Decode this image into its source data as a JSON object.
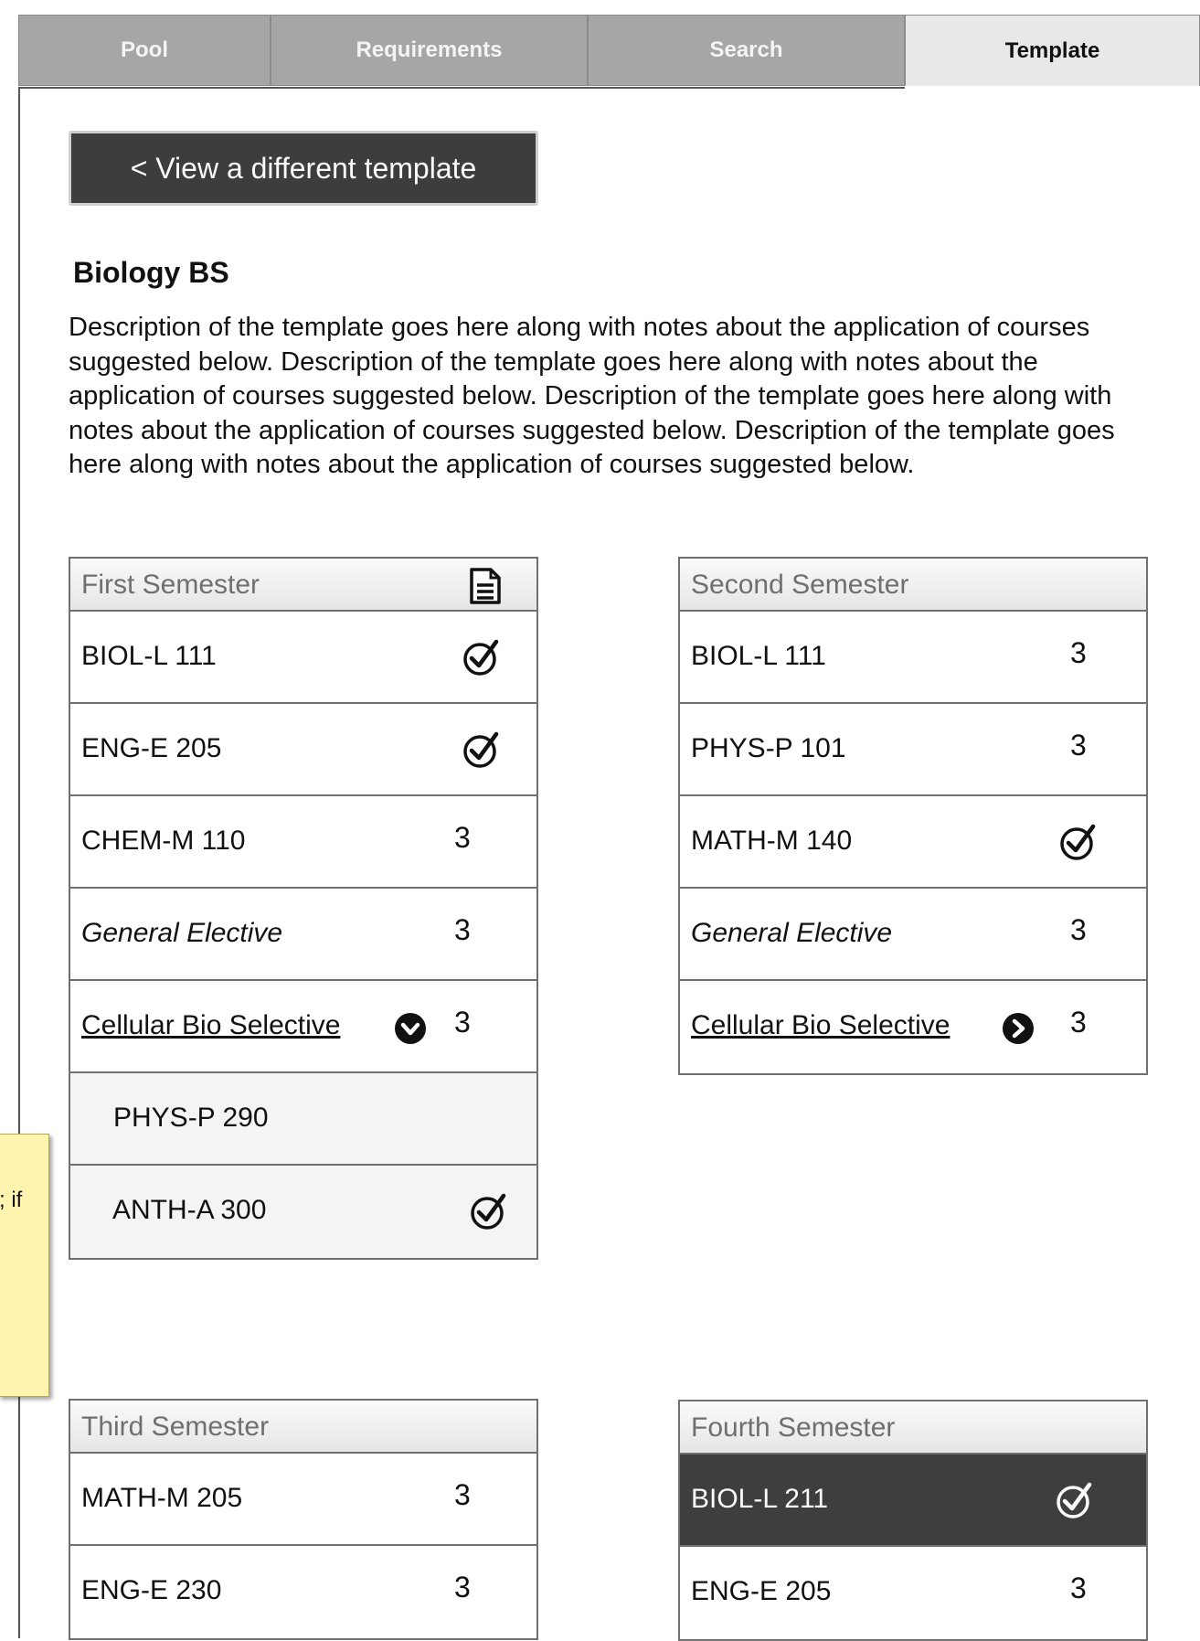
{
  "tabs": [
    {
      "label": "Pool",
      "active": false
    },
    {
      "label": "Requirements",
      "active": false
    },
    {
      "label": "Search",
      "active": false
    },
    {
      "label": "Template",
      "active": true
    }
  ],
  "back_button": "< View a different template",
  "template": {
    "title": "Biology BS",
    "description": "Description of the template goes here along with notes about the application of courses suggested below.  Description of the template goes here along with notes about the application of courses suggested below. Description of the template goes here along with notes about the application of courses suggested below. Description of the template goes here along with notes about the application of courses suggested below."
  },
  "sticky_note": {
    "visible_text": "; if"
  },
  "semesters": [
    {
      "title": "First Semester",
      "rows": [
        {
          "label": "BIOL-L 111",
          "credits": "",
          "status": "check-circle-icon"
        },
        {
          "label": "ENG-E 205",
          "credits": "",
          "status": "check-circle-icon"
        },
        {
          "label": "CHEM-M 110",
          "credits": "3"
        },
        {
          "label": "General Elective",
          "credits": "3"
        },
        {
          "label": "Cellular Bio Selective",
          "credits": "3",
          "expand_icon": "chevron-down-icon"
        },
        {
          "label": "PHYS-P 290",
          "credits": ""
        },
        {
          "label": "ANTH-A 300",
          "credits": "",
          "status": "check-circle-icon"
        }
      ]
    },
    {
      "title": "Second Semester",
      "rows": [
        {
          "label": "BIOL-L 111",
          "credits": "3"
        },
        {
          "label": "PHYS-P 101",
          "credits": "3"
        },
        {
          "label": "MATH-M 140",
          "credits": "",
          "status": "check-circle-icon"
        },
        {
          "label": "General Elective",
          "credits": "3"
        },
        {
          "label": "Cellular Bio Selective",
          "credits": "3",
          "expand_icon": "chevron-right-icon"
        }
      ]
    },
    {
      "title": "Third Semester",
      "rows": [
        {
          "label": "MATH-M 205",
          "credits": "3"
        },
        {
          "label": "ENG-E 230",
          "credits": "3"
        }
      ]
    },
    {
      "title": "Fourth Semester",
      "rows": [
        {
          "label": "BIOL-L 211",
          "credits": "",
          "status": "check-circle-icon",
          "selected": true
        },
        {
          "label": "ENG-E 205",
          "credits": "3"
        }
      ]
    }
  ],
  "colors": {
    "tab_inactive": "#a6a6a6",
    "tab_active": "#e8e8e8",
    "button_dark": "#3d3d3d",
    "sticky_note": "#fff3b0"
  }
}
